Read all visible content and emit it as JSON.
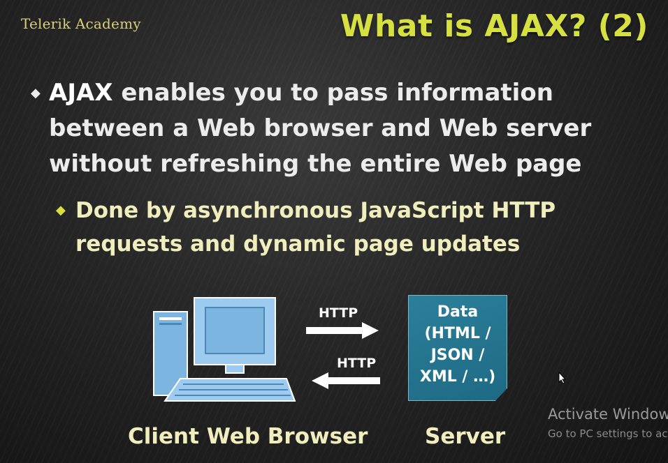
{
  "header": {
    "logo": "Telerik Academy",
    "title": "What is AJAX? (2)"
  },
  "bullets": {
    "main_highlight": "AJAX",
    "main_text": " enables you to pass information between a Web browser and Web server without refreshing the entire Web page",
    "sub_text": "Done by asynchronous JavaScript HTTP requests and dynamic page updates"
  },
  "diagram": {
    "http_request_label": "HTTP",
    "http_response_label": "HTTP",
    "server_box_lines": [
      "Data",
      "(HTML /",
      "JSON /",
      "XML / …)"
    ],
    "client_caption": "Client Web Browser",
    "server_caption": "Server"
  },
  "watermark": {
    "line1": "Activate Window",
    "line2": "Go to PC settings to ac"
  },
  "colors": {
    "title": "#d6e040",
    "server_box": "#2c7f9a",
    "sub_bullet_text": "#f0eebc"
  },
  "icons": [
    "diamond-bullet-icon",
    "computer-icon",
    "arrow-right-icon",
    "arrow-left-icon",
    "mouse-cursor-icon"
  ]
}
